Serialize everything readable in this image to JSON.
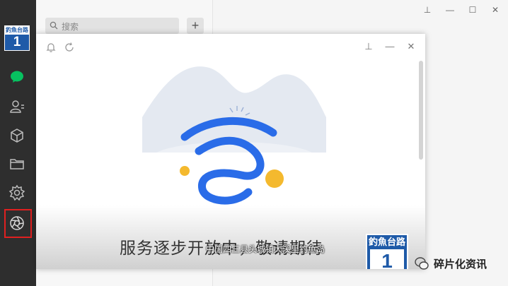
{
  "sidebar": {
    "avatar": {
      "top_text": "釣魚台路",
      "number": "1"
    },
    "icons": [
      "chat-icon",
      "contacts-icon",
      "cube-icon",
      "folder-icon",
      "gear-icon",
      "aperture-icon"
    ],
    "selected_icon": "aperture-icon",
    "highlight_color": "#e02020"
  },
  "list": {
    "search_placeholder": "搜索",
    "add_label": "+"
  },
  "window_controls": {
    "pin": "⊥",
    "minimize": "—",
    "maximize": "☐",
    "close": "✕"
  },
  "overlay": {
    "controls": {
      "pin": "⊥",
      "minimize": "—",
      "close": "✕"
    },
    "status_text": "服务逐步开放中，敬请期待",
    "caption": "中国四三县头城镇大溪里钓鱼岛",
    "logo": {
      "top_text": "釣魚台路",
      "number": "1"
    },
    "colors": {
      "wave": "#2a6ce8",
      "dot": "#f4b92e",
      "mountain": "#e3e8f0"
    }
  },
  "watermark": {
    "text": "碎片化资讯"
  }
}
